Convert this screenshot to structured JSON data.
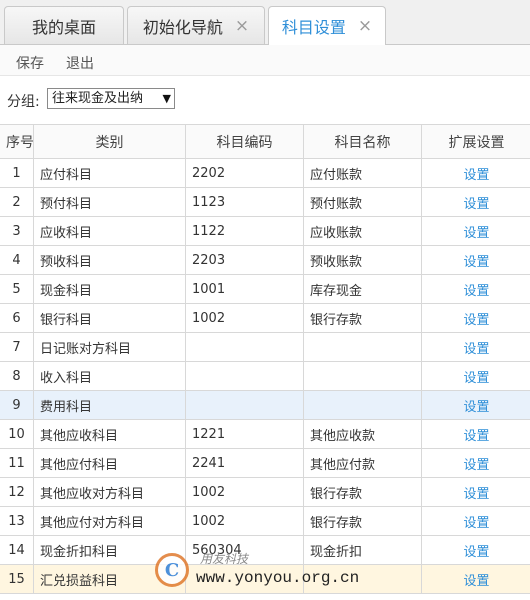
{
  "tabs": [
    {
      "label": "我的桌面",
      "closable": false
    },
    {
      "label": "初始化导航",
      "closable": true
    },
    {
      "label": "科目设置",
      "closable": true,
      "active": true
    }
  ],
  "close_glyph": "×",
  "toolbar": {
    "save_label": "保存",
    "exit_label": "退出"
  },
  "group": {
    "label": "分组:",
    "selected": "往来现金及出纳"
  },
  "table": {
    "columns": [
      "序号",
      "类别",
      "科目编码",
      "科目名称",
      "扩展设置"
    ],
    "rows": [
      [
        "1",
        "应付科目",
        "2202",
        "应付账款",
        "设置"
      ],
      [
        "2",
        "预付科目",
        "1123",
        "预付账款",
        "设置"
      ],
      [
        "3",
        "应收科目",
        "1122",
        "应收账款",
        "设置"
      ],
      [
        "4",
        "预收科目",
        "2203",
        "预收账款",
        "设置"
      ],
      [
        "5",
        "现金科目",
        "1001",
        "库存现金",
        "设置"
      ],
      [
        "6",
        "银行科目",
        "1002",
        "银行存款",
        "设置"
      ],
      [
        "7",
        "日记账对方科目",
        "",
        "",
        "设置"
      ],
      [
        "8",
        "收入科目",
        "",
        "",
        "设置"
      ],
      [
        "9",
        "费用科目",
        "",
        "",
        "设置"
      ],
      [
        "10",
        "其他应收科目",
        "1221",
        "其他应收款",
        "设置"
      ],
      [
        "11",
        "其他应付科目",
        "2241",
        "其他应付款",
        "设置"
      ],
      [
        "12",
        "其他应收对方科目",
        "1002",
        "银行存款",
        "设置"
      ],
      [
        "13",
        "其他应付对方科目",
        "1002",
        "银行存款",
        "设置"
      ],
      [
        "14",
        "现金折扣科目",
        "560304",
        "现金折扣",
        "设置"
      ],
      [
        "15",
        "汇兑损益科目",
        "",
        "",
        "设置"
      ]
    ]
  },
  "watermark": {
    "brand": "用友科技",
    "url": "www.yonyou.org.cn"
  },
  "colors": {
    "accent": "#2f8fd8",
    "highlight_row": "#e8f1fb",
    "watermark_orange": "#e07a2e"
  }
}
